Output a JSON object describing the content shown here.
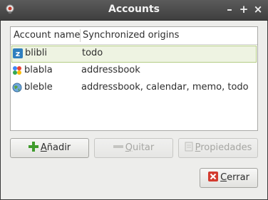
{
  "window": {
    "title": "Accounts",
    "controls": {
      "minimize": "–",
      "maximize": "+",
      "close": "×"
    }
  },
  "table": {
    "headers": {
      "name": "Account name",
      "origins": "Synchronized origins"
    },
    "rows": [
      {
        "name": "blibli",
        "origins": "todo",
        "icon": "zimbra-icon"
      },
      {
        "name": "blabla",
        "origins": "addressbook",
        "icon": "google-icon"
      },
      {
        "name": "bleble",
        "origins": "addressbook, calendar, memo, todo",
        "icon": "globe-icon"
      }
    ]
  },
  "buttons": {
    "add": {
      "mnemonic": "A",
      "rest": "ñadir"
    },
    "remove": {
      "mnemonic": "Q",
      "rest": "uitar"
    },
    "properties": {
      "mnemonic": "P",
      "rest": "ropiedades"
    },
    "close": {
      "mnemonic": "C",
      "rest": "errar"
    }
  },
  "colors": {
    "selection_bg": "#eef3e2",
    "selection_border": "#b4cc84",
    "titlebar": "#4a4a4a"
  }
}
